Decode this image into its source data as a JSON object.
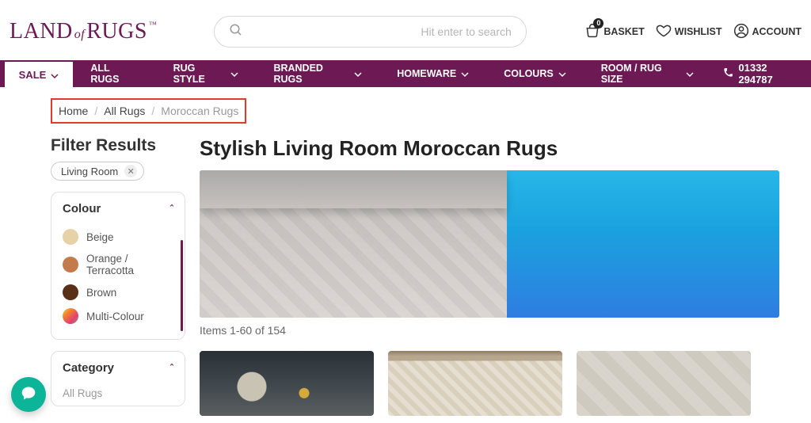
{
  "header": {
    "logo": {
      "land": "LAND",
      "of": "of",
      "rugs": "RUGS",
      "tm": "™"
    },
    "search_placeholder": "Hit enter to search",
    "basket_label": "BASKET",
    "basket_count": "0",
    "wishlist_label": "WISHLIST",
    "account_label": "ACCOUNT"
  },
  "nav": {
    "sale": "SALE",
    "items": [
      "ALL RUGS",
      "RUG STYLE",
      "BRANDED RUGS",
      "HOMEWARE",
      "COLOURS",
      "ROOM / RUG SIZE"
    ],
    "phone": "01332 294787"
  },
  "breadcrumb": {
    "home": "Home",
    "all": "All Rugs",
    "current": "Moroccan Rugs",
    "sep": "/"
  },
  "sidebar": {
    "filter_title": "Filter Results",
    "active_chip": "Living Room",
    "colour_heading": "Colour",
    "colours": [
      {
        "name": "Beige",
        "swatch": "#e7d2a8"
      },
      {
        "name": "Orange / Terracotta",
        "swatch": "#c47a4a"
      },
      {
        "name": "Brown",
        "swatch": "#5a2f17"
      },
      {
        "name": "Multi-Colour",
        "swatch": "linear-gradient(135deg,#f7d23e 0%,#f07b2e 35%,#e23c79 70%,#6fbf4b 100%)"
      }
    ],
    "category_heading": "Category",
    "category_items": [
      "All Rugs"
    ]
  },
  "main": {
    "title": "Stylish Living Room Moroccan Rugs",
    "results_count": "Items 1-60 of 154"
  }
}
